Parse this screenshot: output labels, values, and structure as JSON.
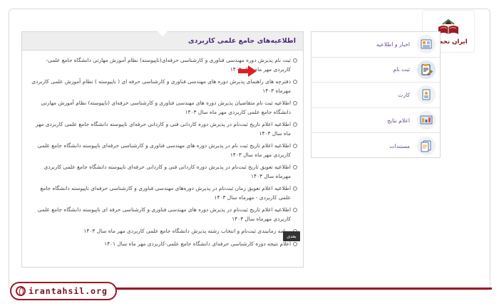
{
  "brand": {
    "logo_text": "ایران تحصیل",
    "watermark": "irantahsil.org"
  },
  "panel": {
    "title": "اطلاعیه‌های جامع علمی کاربردی",
    "items": [
      "ثبت نام پذیرش دوره مهندسی فناوری و کارشناسی حرفه‌ای(ناپیوسته) نظام آموزش مهارتی دانشگاه جامع علمی- کاربردی مهر ماه سال ۱۴۰۳",
      "دفترچه های راهنمای پذیرش دوره های مهندسی فناوری و کارشناسی حرفه ای ( ناپیوسته ) نظام آموزش علمی کاربردی مهرماه ۱۴۰۳",
      "اطلاعیه ثبت نام متقاضیان پذیرش دوره های مهندسی فناوری و کارشناسی حرفه‌ای (ناپیوسته) نظام آموزش مهارتی دانشگاه جامع علمی کاربردی مهر ماه سال ۱۴۰۳",
      "اطلاعیه اعلام تاریخ ثبت‌نام در پذیرش دوره کاردانی فنی و کاردانی حرفه‌ای ناپیوسته دانشگاه جامع علمی کاربردی مهر ماه سال ۱۴۰۳",
      "اطلاعیه اعلام تاریخ ثبت نام در پذیرش دوره های مهندسی فناوری و کارشناسی حرفه‌ای ناپیوسته دانشگاه جامع علمی کاربردی مهر ماه سال ۱۴۰۳",
      "اطلاعیه تعویق تاریخ ثبت‌نام در پذیرش دوره کاردانی فنی و کاردانی حرفه‌ای ناپیوسته دانشگاه جامع علمی کاربردی مهرماه سال ۱۴۰۳",
      "اطلاعیه اعلام تعویق زمان ثبت‌نام در پذیرش دوره‌های مهندسی فناوری و کارشناسی حرفه‌ای ناپیوسته دانشگاه جامع علمی کاربردی - مهرماه سال ۱۴۰۳",
      "اطلاعیه اعلام تاریخ ثبت‌نام در پذیرش دوره های مهندسی فناوری و کارشناسی حرفه ای ناپیوسته دانشگاه جامع علمی کاربردی مهرماه سال ۱۴۰۳",
      "برنامه زمانبندی ثبت‌نام و انتخاب رشته پذیرش دانشگاه جامع علمی کاربردی مهر ماه سال ۱۴۰۳",
      "اعلام نتیجه دوره کارشناسی حرفه‌ای دانشگاه جامع علمی-کاربردی مهر ماه سال ۱۴۰۱"
    ],
    "next_label": "بعدی"
  },
  "sidebar": {
    "items": [
      {
        "label": "اخبار و اطلاعیه",
        "icon": "news-icon"
      },
      {
        "label": "ثبت نام",
        "icon": "clipboard-edit-icon"
      },
      {
        "label": "کارت",
        "icon": "id-card-icon"
      },
      {
        "label": "اعلام نتایج",
        "icon": "results-icon"
      },
      {
        "label": "مستندات",
        "icon": "documents-icon"
      }
    ]
  },
  "colors": {
    "brand": "#9b1b2a",
    "accent": "#4b2a7a",
    "arrow": "#e02020"
  }
}
